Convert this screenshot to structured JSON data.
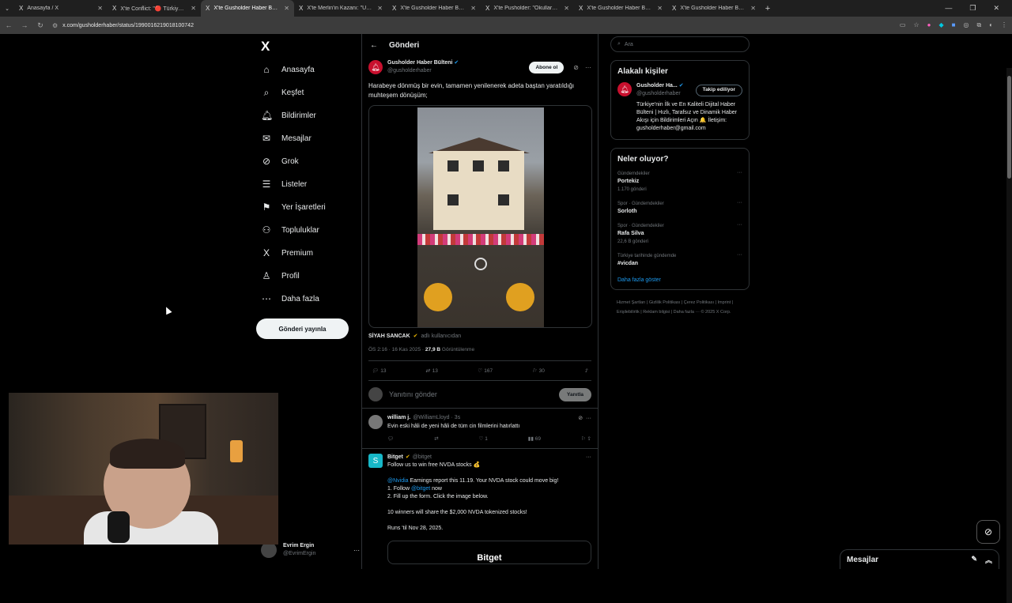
{
  "browser": {
    "tabs": [
      {
        "icon": "X",
        "title": "Anasayfa / X",
        "active": false
      },
      {
        "icon": "X",
        "title": "X'te Conflict: \"🔴 Türkiye geneli",
        "active": false
      },
      {
        "icon": "X",
        "title": "X'te Gusholder Haber Bülteni:",
        "active": true
      },
      {
        "icon": "X",
        "title": "X'te Merlin'in Kazanı: \"Uzun sür",
        "active": false
      },
      {
        "icon": "X",
        "title": "X'te Gusholder Haber Bülteni:",
        "active": false
      },
      {
        "icon": "X",
        "title": "X'te Pusholder: \"Okullarda ara",
        "active": false
      },
      {
        "icon": "X",
        "title": "X'te Gusholder Haber Bülteni:",
        "active": false
      },
      {
        "icon": "X",
        "title": "X'te Gusholder Haber Bülteni:",
        "active": false
      }
    ],
    "url": "x.com/gusholderhaber/status/1990016219018100742"
  },
  "nav": {
    "items": [
      {
        "icon": "⌂",
        "label": "Anasayfa"
      },
      {
        "icon": "⌕",
        "label": "Keşfet"
      },
      {
        "icon": "🔔︎",
        "label": "Bildirimler"
      },
      {
        "icon": "✉",
        "label": "Mesajlar"
      },
      {
        "icon": "⊘",
        "label": "Grok"
      },
      {
        "icon": "☰",
        "label": "Listeler"
      },
      {
        "icon": "⚑",
        "label": "Yer İşaretleri"
      },
      {
        "icon": "⚇",
        "label": "Topluluklar"
      },
      {
        "icon": "X",
        "label": "Premium"
      },
      {
        "icon": "♙",
        "label": "Profil"
      },
      {
        "icon": "⋯",
        "label": "Daha fazla"
      }
    ],
    "post_button": "Gönderi yayınla"
  },
  "account": {
    "name": "Evrim Ergin",
    "handle": "@EvrimErgin"
  },
  "main": {
    "header": "Gönderi",
    "tweet": {
      "name": "Gusholder Haber Bülteni",
      "handle": "@gusholderhaber",
      "subscribe": "Abone ol",
      "text": "Harabeye dönmüş bir evin, tamamen yenilenerek adeta baştan yaratıldığı muhteşem dönüşüm;",
      "attribution_name": "SİYAH SANCAK",
      "attribution_suffix": "adlı kullanıcıdan",
      "time": "ÖS 2:16 · 16 Kas 2025 ·",
      "views": "27,9 B",
      "views_label": "Görüntülenme",
      "replies": "13",
      "retweets": "13",
      "likes": "167",
      "bookmarks": "30"
    },
    "reply_box": {
      "placeholder": "Yanıtını gönder",
      "button": "Yanıtla"
    },
    "reply": {
      "name": "william j.",
      "handle": "@WilliamLloyd · 3s",
      "text": "Evin eski hâli de yeni hâli de tüm cin filmlerini hatırlattı",
      "likes": "1",
      "views": "69"
    },
    "ad": {
      "name": "Bitget",
      "handle": "@bitget",
      "line1": "Follow us to win free NVDA stocks 💰",
      "mention1": "@Nvidia",
      "line2": " Earnings report this 11.19. Your NVDA stock could move big!",
      "line3a": "1. Follow ",
      "mention2": "@bitget",
      "line3b": " now",
      "line4": "2. Fill up the form. Click the image below.",
      "line5": "10 winners will share the $2,000 NVDA tokenized stocks!",
      "line6": "Runs 'til Nov 28, 2025.",
      "card": "Bitget"
    }
  },
  "right": {
    "search_placeholder": "Ara",
    "related": {
      "title": "Alakalı kişiler",
      "name": "Gusholder Ha...",
      "handle": "@gusholderhaber",
      "follow": "Takip ediliyor",
      "bio": "Türkiye'nin İlk ve En Kaliteli Dijital Haber Bülteni | Hızlı, Tarafsız ve Dinamik Haber Akışı için Bildirimleri Açın 🔔 İletişim: gusholderhaber@gmail.com"
    },
    "trends": {
      "title": "Neler oluyor?",
      "items": [
        {
          "cat": "Gündemdekiler",
          "name": "Portekiz",
          "count": "1.170 gönderi"
        },
        {
          "cat": "Spor · Gündemdekiler",
          "name": "Sorloth",
          "count": ""
        },
        {
          "cat": "Spor · Gündemdekiler",
          "name": "Rafa Silva",
          "count": "22,6 B gönderi"
        },
        {
          "cat": "Türkiye tarihinde gündemde",
          "name": "#vicdan",
          "count": ""
        }
      ],
      "show_more": "Daha fazla göster"
    },
    "footer": "Hizmet Şartları  |  Gizlilik Politikası  |  Çerez Politikası  |  Imprint  |  Erişilebilirlik  |  Reklam bilgisi  |  Daha fazla ···  © 2025 X Corp."
  },
  "messages_bar": "Mesajlar",
  "colors": {
    "accent": "#1d9bf0",
    "bg": "#000000",
    "border": "#2f3336"
  }
}
